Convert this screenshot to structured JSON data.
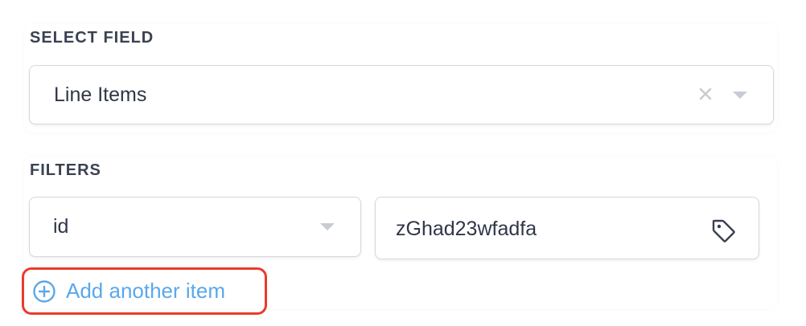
{
  "select_field": {
    "label": "SELECT FIELD",
    "value": "Line Items"
  },
  "filters": {
    "label": "FILTERS",
    "key_value": "id",
    "value": "zGhad23wfadfa"
  },
  "add_item": {
    "label": "Add another item"
  },
  "icons": {
    "clear": "close-icon",
    "dropdown": "chevron-down-icon",
    "tag": "tag-icon",
    "add": "plus-circle-icon"
  },
  "colors": {
    "accent": "#5aa8ea",
    "highlight": "#ea3b2a",
    "border": "#d3d7de",
    "text": "#2f3747"
  }
}
